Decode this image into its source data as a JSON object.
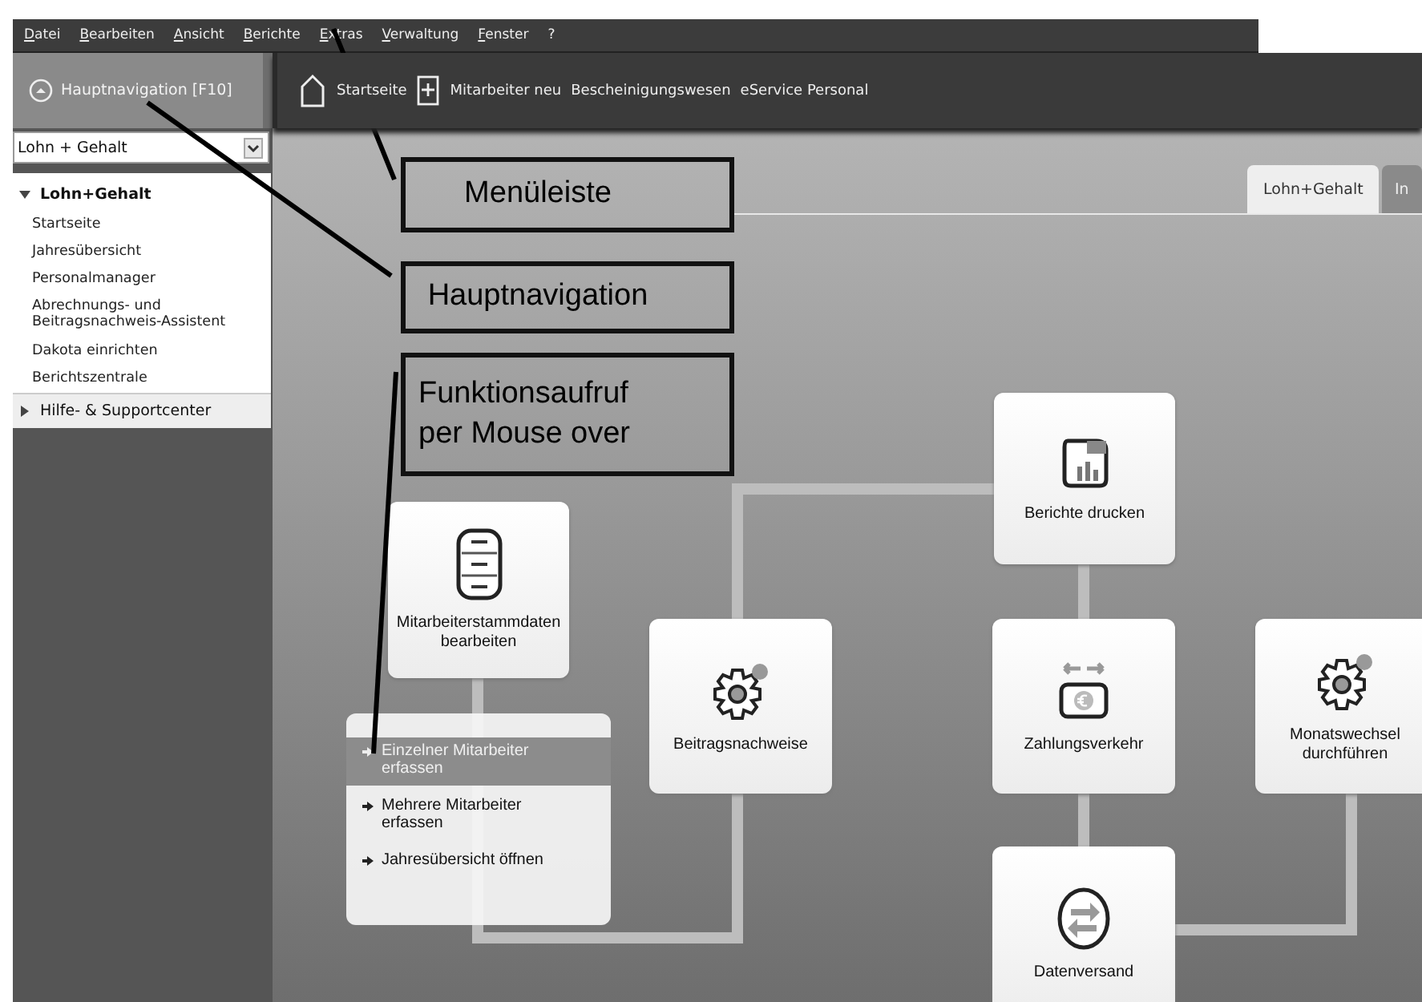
{
  "menu_bar": {
    "items": [
      {
        "label": "Datei"
      },
      {
        "label": "Bearbeiten"
      },
      {
        "label": "Ansicht"
      },
      {
        "label": "Berichte"
      },
      {
        "label": "Extras"
      },
      {
        "label": "Verwaltung"
      },
      {
        "label": "Fenster"
      },
      {
        "label": "?"
      }
    ]
  },
  "toolbar": {
    "nav_button": "Hauptnavigation [F10]",
    "items": [
      {
        "label": "Startseite",
        "kind": "home"
      },
      {
        "label": "Mitarbeiter neu",
        "kind": "new"
      },
      {
        "label": "Bescheinigungswesen",
        "kind": "text"
      },
      {
        "label": "eService Personal",
        "kind": "text"
      }
    ]
  },
  "sidebar": {
    "module_select": "Lohn + Gehalt",
    "tree": [
      {
        "label": "Lohn+Gehalt",
        "expanded": true,
        "children": [
          {
            "label": "Startseite"
          },
          {
            "label": "Jahresübersicht"
          },
          {
            "label": "Personalmanager"
          },
          {
            "label": "Abrechnungs- und Beitragsnachweis-Assistent"
          },
          {
            "label": "Dakota einrichten"
          },
          {
            "label": "Berichtszentrale"
          }
        ]
      },
      {
        "label": "Hilfe- & Supportcenter",
        "expanded": false
      }
    ]
  },
  "tabs": [
    {
      "label": "Lohn+Gehalt",
      "selected": true
    },
    {
      "label": "In",
      "selected": false
    }
  ],
  "tiles": [
    {
      "label": "Berichte drucken",
      "kind": "report"
    },
    {
      "label": "Mitarbeiterstammdaten bearbeiten",
      "kind": "cabinet"
    },
    {
      "label": "Beitragsnachweise",
      "kind": "gear"
    },
    {
      "label": "Zahlungsverkehr",
      "kind": "payment"
    },
    {
      "label": "Monatswechsel durchführen",
      "kind": "gear"
    },
    {
      "label": "Datenversand",
      "kind": "transfer"
    }
  ],
  "popup_menu": {
    "items": [
      {
        "label": "Einzelner Mitarbeiter erfassen",
        "selected": true
      },
      {
        "label": "Mehrere Mitarbeiter erfassen",
        "selected": false
      },
      {
        "label": "Jahresübersicht öffnen",
        "selected": false
      }
    ]
  },
  "callouts": [
    {
      "text": "Menüleiste"
    },
    {
      "text": "Hauptnavigation"
    },
    {
      "text": "Funktionsaufruf per Mouse over"
    }
  ]
}
